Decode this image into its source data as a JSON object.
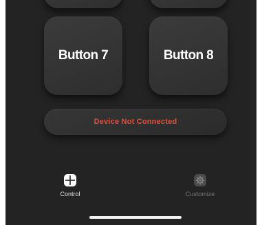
{
  "buttons": [
    {
      "label": "Button 7"
    },
    {
      "label": "Button 8"
    }
  ],
  "status": {
    "text": "Device Not Connected",
    "color": "#e0503c"
  },
  "tabs": [
    {
      "label": "Control",
      "icon": "grid-icon",
      "active": true
    },
    {
      "label": "Customize",
      "icon": "gear-icon",
      "active": false
    }
  ],
  "colors": {
    "background": "#232323",
    "button": "#333333",
    "active_tab": "#e8e8e8",
    "inactive_tab": "#777777"
  }
}
